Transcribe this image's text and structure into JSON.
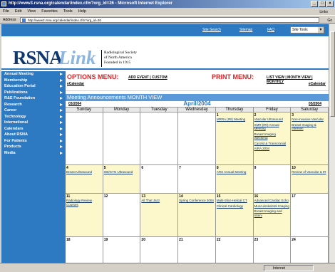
{
  "window": {
    "title": "http://www3.rsna.org/calendar/index.cfm?org_id=26 - Microsoft Internet Explorer"
  },
  "menubar": {
    "items": [
      "File",
      "Edit",
      "View",
      "Favorites",
      "Tools",
      "Help"
    ],
    "links_label": "Links"
  },
  "address": {
    "label": "Address",
    "value": "http://www3.rsna.org/calendar/index.cfm?org_id=26",
    "go": "Go"
  },
  "topnav": {
    "search": "Site Search",
    "sitemap": "Sitemap",
    "faq": "FAQ",
    "site_tools": "Site Tools"
  },
  "logo": {
    "brand1": "RSNA",
    "brand2": "Link",
    "line1": "Radiological Society",
    "line2": "of North America",
    "line3": "Founded in 1915"
  },
  "sidebar": {
    "items": [
      "Annual Meeting",
      "Membership",
      "Education Portal",
      "Publications",
      "R&E Foundation",
      "Research",
      "Career",
      "Technology",
      "International",
      "Calendars",
      "About RSNA",
      "For Patients",
      "Products",
      "Media"
    ]
  },
  "options": {
    "title": "OPTIONS MENU:",
    "links": "ADD EVENT | CUSTOM",
    "ecalendar": "eCalendar",
    "print_title": "PRINT MENU:",
    "print_links": "LIST VIEW | MONTH VIEW | MONTHLY",
    "print_ecal": "eCalendar"
  },
  "calendar": {
    "header": "Meeting Announcements MONTH VIEW",
    "prev": "03/2004",
    "month": "April/2004",
    "next": "05/2004",
    "days": [
      "Sunday",
      "Monday",
      "Tuesday",
      "Wednesday",
      "Thursday",
      "Friday",
      "Saturday"
    ],
    "weeks": [
      [
        {
          "d": "",
          "e": []
        },
        {
          "d": "",
          "e": []
        },
        {
          "d": "",
          "e": []
        },
        {
          "d": "",
          "e": []
        },
        {
          "d": "1",
          "e": [
            "MRRA (IRI) Meeting"
          ]
        },
        {
          "d": "2",
          "e": [
            "Vascular Ultrasound",
            "SMR (IRI) Annual Meeting",
            "Breast Imaging Weekend",
            "Carotid & Transcranial",
            "AIRA 2004"
          ]
        },
        {
          "d": "3",
          "e": [
            "Non-Invasive Vascular",
            "Breast Imaging & Interven"
          ]
        }
      ],
      [
        {
          "d": "4",
          "e": [
            "Breast Ultrasound"
          ]
        },
        {
          "d": "5",
          "e": [
            "OB/GYN Ultrasound"
          ]
        },
        {
          "d": "6",
          "e": []
        },
        {
          "d": "7",
          "e": []
        },
        {
          "d": "8",
          "e": [
            "ARS Annual Meeting"
          ]
        },
        {
          "d": "9",
          "e": []
        },
        {
          "d": "10",
          "e": [
            "Review of Vascular & IR"
          ]
        }
      ],
      [
        {
          "d": "11",
          "e": [
            "Radiology Review Courses"
          ]
        },
        {
          "d": "12",
          "e": []
        },
        {
          "d": "13",
          "e": [
            "All That Jazz"
          ]
        },
        {
          "d": "14",
          "e": [
            "Spring Conference 2004"
          ]
        },
        {
          "d": "15",
          "e": [
            "Multi-Slice Helical CT",
            "Clinical Cardiology"
          ]
        },
        {
          "d": "16",
          "e": [
            "Advanced Cardiac Echo",
            "Musculoskeletal Imaging",
            "Breast Imaging and Interv"
          ]
        },
        {
          "d": "17",
          "e": []
        }
      ],
      [
        {
          "d": "18",
          "e": []
        },
        {
          "d": "19",
          "e": []
        },
        {
          "d": "20",
          "e": []
        },
        {
          "d": "21",
          "e": []
        },
        {
          "d": "22",
          "e": []
        },
        {
          "d": "23",
          "e": []
        },
        {
          "d": "24",
          "e": []
        }
      ]
    ]
  },
  "status": {
    "zone": "Internet"
  }
}
